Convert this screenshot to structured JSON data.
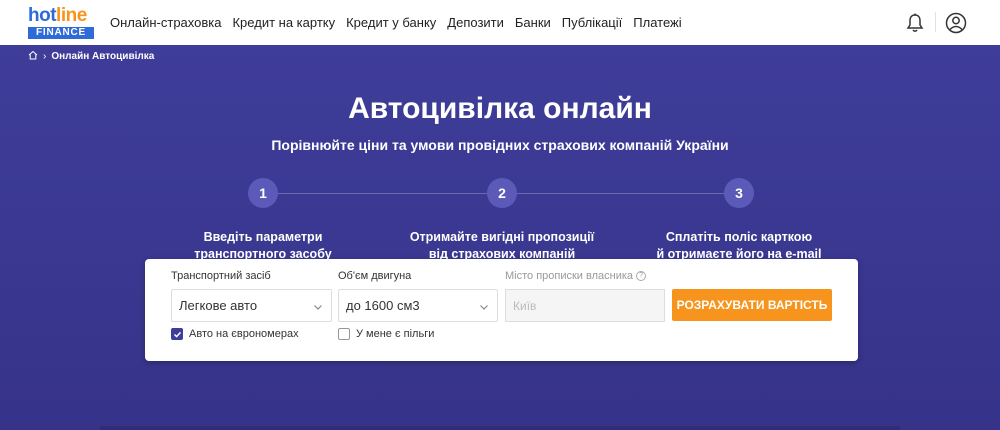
{
  "header": {
    "logo": {
      "hot": "hot",
      "line": "line",
      "finance": "FINANCE"
    },
    "nav": [
      "Онлайн-страховка",
      "Кредит на картку",
      "Кредит у банку",
      "Депозити",
      "Банки",
      "Публікації",
      "Платежі"
    ],
    "icons": {
      "bell": "bell-icon",
      "user": "user-icon"
    }
  },
  "breadcrumb": {
    "home_icon": "home-icon",
    "current": "Онлайн Автоцивілка"
  },
  "hero": {
    "title": "Автоцивілка онлайн",
    "subtitle": "Порівнюйте ціни та умови провідних страхових компаній України"
  },
  "steps": [
    {
      "number": "1",
      "line1": "Введіть параметри",
      "line2": "транспортного засобу"
    },
    {
      "number": "2",
      "line1": "Отримайте вигідні пропозиції",
      "line2": "від страхових компаній"
    },
    {
      "number": "3",
      "line1": "Сплатіть поліс карткою",
      "line2": "й отримаєте його на e-mail"
    }
  ],
  "form": {
    "vehicle": {
      "label": "Транспортний засіб",
      "value": "Легкове авто"
    },
    "engine": {
      "label": "Об'єм двигуна",
      "value": "до 1600 см3"
    },
    "city": {
      "label": "Місто прописки власника",
      "placeholder": "Київ"
    },
    "submit_label": "РОЗРАХУВАТИ ВАРТІСТЬ",
    "checkbox_euro": {
      "label": "Авто на єврономерах",
      "checked": true
    },
    "checkbox_benefits": {
      "label": "У мене є пільги",
      "checked": false
    }
  },
  "colors": {
    "accent": "#f7941d",
    "hero_bg": "#3e3d99",
    "brand_blue": "#2f6bd8"
  }
}
